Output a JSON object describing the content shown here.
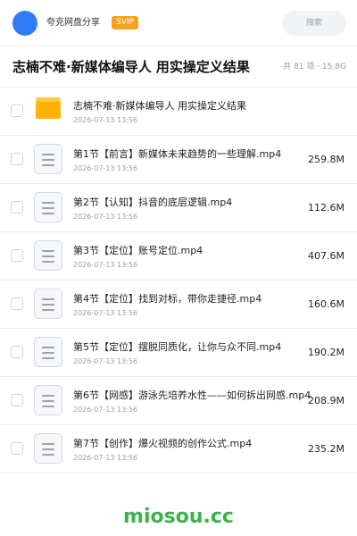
{
  "header": {
    "share_name": "夸克网盘分享",
    "badge": "SVIP",
    "search_placeholder": "搜索"
  },
  "folder": {
    "title": "志楠不难·新媒体编导人 用实操定义结果",
    "meta": "共 81 项 · 15.8G"
  },
  "items": [
    {
      "type": "folder",
      "name": "志楠不难·新媒体编导人 用实操定义结果",
      "date": "2026-07-13 13:56",
      "size": ""
    },
    {
      "type": "video",
      "name": "第1节【前言】新媒体未来趋势的一些理解.mp4",
      "date": "2026-07-13 13:56",
      "size": "259.8M"
    },
    {
      "type": "video",
      "name": "第2节【认知】抖音的底层逻辑.mp4",
      "date": "2026-07-13 13:56",
      "size": "112.6M"
    },
    {
      "type": "video",
      "name": "第3节【定位】账号定位.mp4",
      "date": "2026-07-13 13:56",
      "size": "407.6M"
    },
    {
      "type": "video",
      "name": "第4节【定位】找到对标，带你走捷径.mp4",
      "date": "2026-07-13 13:56",
      "size": "160.6M"
    },
    {
      "type": "video",
      "name": "第5节【定位】摆脱同质化，让你与众不同.mp4",
      "date": "2026-07-13 13:56",
      "size": "190.2M"
    },
    {
      "type": "video",
      "name": "第6节【网感】游泳先培养水性——如何拆出网感.mp4",
      "date": "2026-07-13 13:56",
      "size": "208.9M"
    },
    {
      "type": "video",
      "name": "第7节【创作】爆火视频的创作公式.mp4",
      "date": "2026-07-13 13:56",
      "size": "235.2M"
    }
  ],
  "watermark": "miosou.cc",
  "colors": {
    "accent": "#2f7cf6",
    "svip": "#f7a21b",
    "folder": "#ffb300",
    "watermark": "#3bb34a"
  }
}
